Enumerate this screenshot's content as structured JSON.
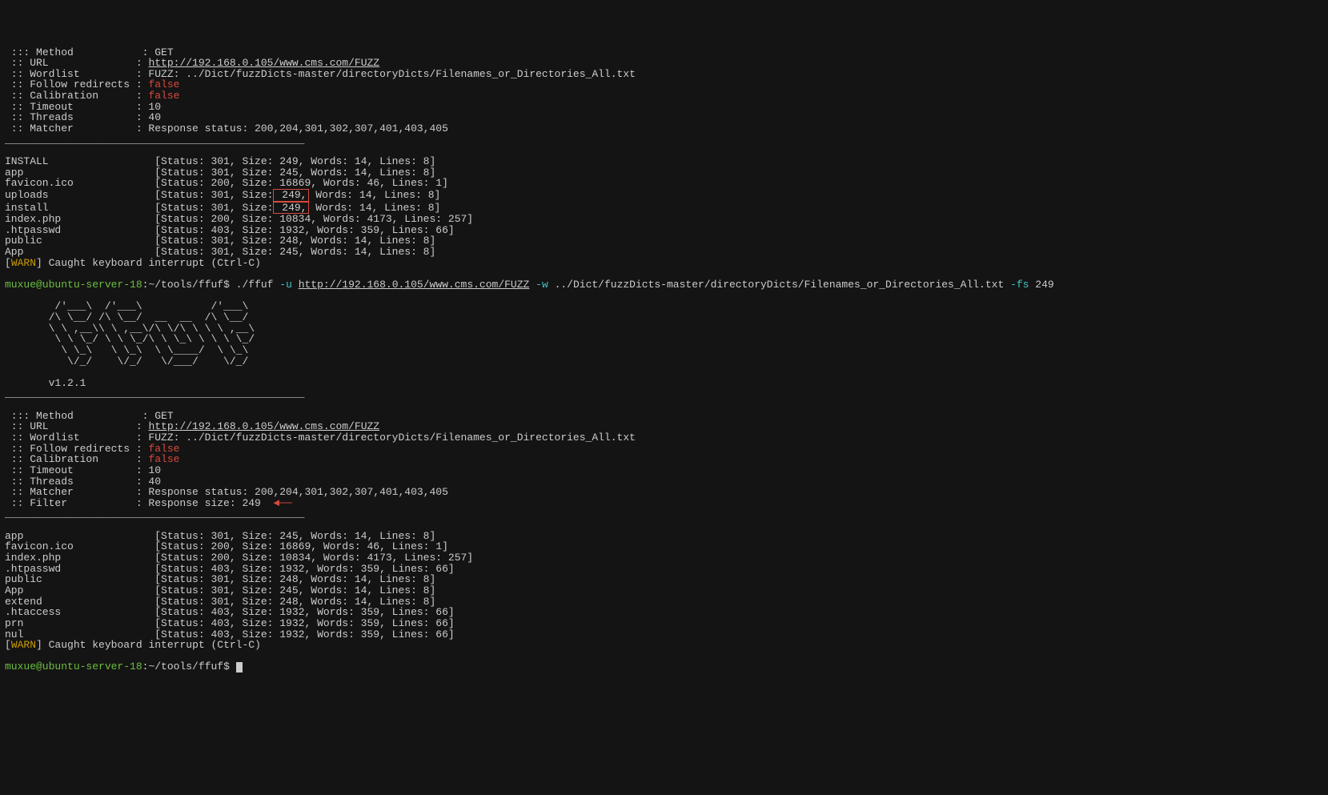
{
  "cfg1": {
    "method_label": ":: Method           :",
    "method_val": "GET",
    "url_label": " :: URL              :",
    "url_val": "http://192.168.0.105/www.cms.com/FUZZ",
    "wl_label": " :: Wordlist         : FUZZ: ../Dict/fuzzDicts-master/directoryDicts/Filenames_or_Directories_All.txt",
    "fr_label": " :: Follow redirects :",
    "fr_val": "false",
    "cal_label": " :: Calibration      :",
    "cal_val": "false",
    "to_label": " :: Timeout          : 10",
    "th_label": " :: Threads          : 40",
    "mt_label": " :: Matcher          : Response status: 200,204,301,302,307,401,403,405"
  },
  "hr": "________________________________________________",
  "r1": {
    "INSTALL": "INSTALL                 [Status: 301, Size: 249, Words: 14, Lines: 8]",
    "app": "app                     [Status: 301, Size: 245, Words: 14, Lines: 8]",
    "favicon": "favicon.ico             [Status: 200, Size: 16869, Words: 46, Lines: 1]",
    "uploads_pre": "uploads                 [Status: 301, Size:",
    "uploads_box": " 249,",
    "uploads_post": " Words: 14, Lines: 8]",
    "install_pre": "install                 [Status: 301, Size:",
    "install_box": " 249,",
    "install_post": " Words: 14, Lines: 8]",
    "index": "index.php               [Status: 200, Size: 10834, Words: 4173, Lines: 257]",
    "htpasswd": ".htpasswd               [Status: 403, Size: 1932, Words: 359, Lines: 66]",
    "public": "public                  [Status: 301, Size: 248, Words: 14, Lines: 8]",
    "App": "App                     [Status: 301, Size: 245, Words: 14, Lines: 8]"
  },
  "warn_l": "[",
  "warn_w": "WARN",
  "warn_r": "] Caught keyboard interrupt (Ctrl-C)",
  "prompt": {
    "user": "muxue@ubuntu-server-18",
    "path": ":~/tools/ffuf",
    "dollar": "$ ",
    "cmd1": "./ffuf ",
    "flag_u": "-u ",
    "cmd_url": "http://192.168.0.105/www.cms.com/FUZZ",
    "flag_w": " -w ",
    "wl": "../Dict/fuzzDicts-master/directoryDicts/Filenames_or_Directories_All.txt ",
    "flag_fs": "-fs ",
    "num": "249"
  },
  "ascii": {
    "l1": "        /'___\\  /'___\\           /'___\\       ",
    "l2": "       /\\ \\__/ /\\ \\__/  __  __  /\\ \\__/       ",
    "l3": "       \\ \\ ,__\\\\ \\ ,__\\/\\ \\/\\ \\ \\ \\ ,__\\      ",
    "l4": "        \\ \\ \\_/ \\ \\ \\_/\\ \\ \\_\\ \\ \\ \\ \\_/      ",
    "l5": "         \\ \\_\\   \\ \\_\\  \\ \\____/  \\ \\_\\       ",
    "l6": "          \\/_/    \\/_/   \\/___/    \\/_/       ",
    "ver": "       v1.2.1"
  },
  "cfg2": {
    "fl_label": " :: Filter           : Response size: 249",
    "arrow": "  ◄──"
  },
  "r2": {
    "app": "app                     [Status: 301, Size: 245, Words: 14, Lines: 8]",
    "favicon": "favicon.ico             [Status: 200, Size: 16869, Words: 46, Lines: 1]",
    "index": "index.php               [Status: 200, Size: 10834, Words: 4173, Lines: 257]",
    "htpasswd": ".htpasswd               [Status: 403, Size: 1932, Words: 359, Lines: 66]",
    "public": "public                  [Status: 301, Size: 248, Words: 14, Lines: 8]",
    "App": "App                     [Status: 301, Size: 245, Words: 14, Lines: 8]",
    "extend": "extend                  [Status: 301, Size: 248, Words: 14, Lines: 8]",
    "htaccess": ".htaccess               [Status: 403, Size: 1932, Words: 359, Lines: 66]",
    "prn": "prn                     [Status: 403, Size: 1932, Words: 359, Lines: 66]",
    "nul": "nul                     [Status: 403, Size: 1932, Words: 359, Lines: 66]"
  }
}
